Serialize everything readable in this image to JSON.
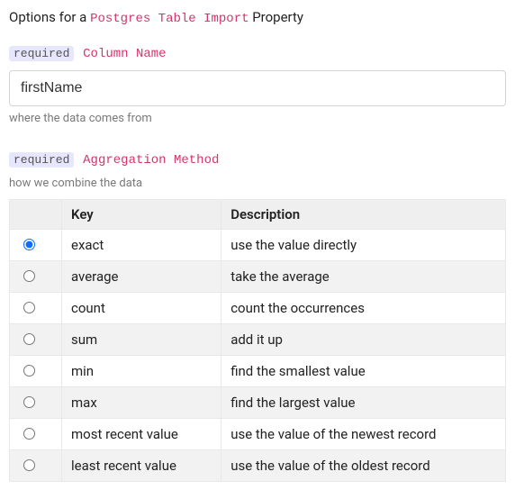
{
  "header": {
    "prefix": "Options for a ",
    "source_name": "Postgres Table Import",
    "suffix": " Property"
  },
  "required_badge": "required",
  "field_column": {
    "label": "Column Name",
    "value": "firstName",
    "helper": "where the data comes from"
  },
  "field_aggregation": {
    "label": "Aggregation Method",
    "helper": "how we combine the data",
    "columns": {
      "c0": "",
      "c1": "Key",
      "c2": "Description"
    },
    "selected_index": 0,
    "options": [
      {
        "key": "exact",
        "description": "use the value directly"
      },
      {
        "key": "average",
        "description": "take the average"
      },
      {
        "key": "count",
        "description": "count the occurrences"
      },
      {
        "key": "sum",
        "description": "add it up"
      },
      {
        "key": "min",
        "description": "find the smallest value"
      },
      {
        "key": "max",
        "description": "find the largest value"
      },
      {
        "key": "most recent value",
        "description": "use the value of the newest record"
      },
      {
        "key": "least recent value",
        "description": "use the value of the oldest record"
      }
    ]
  }
}
